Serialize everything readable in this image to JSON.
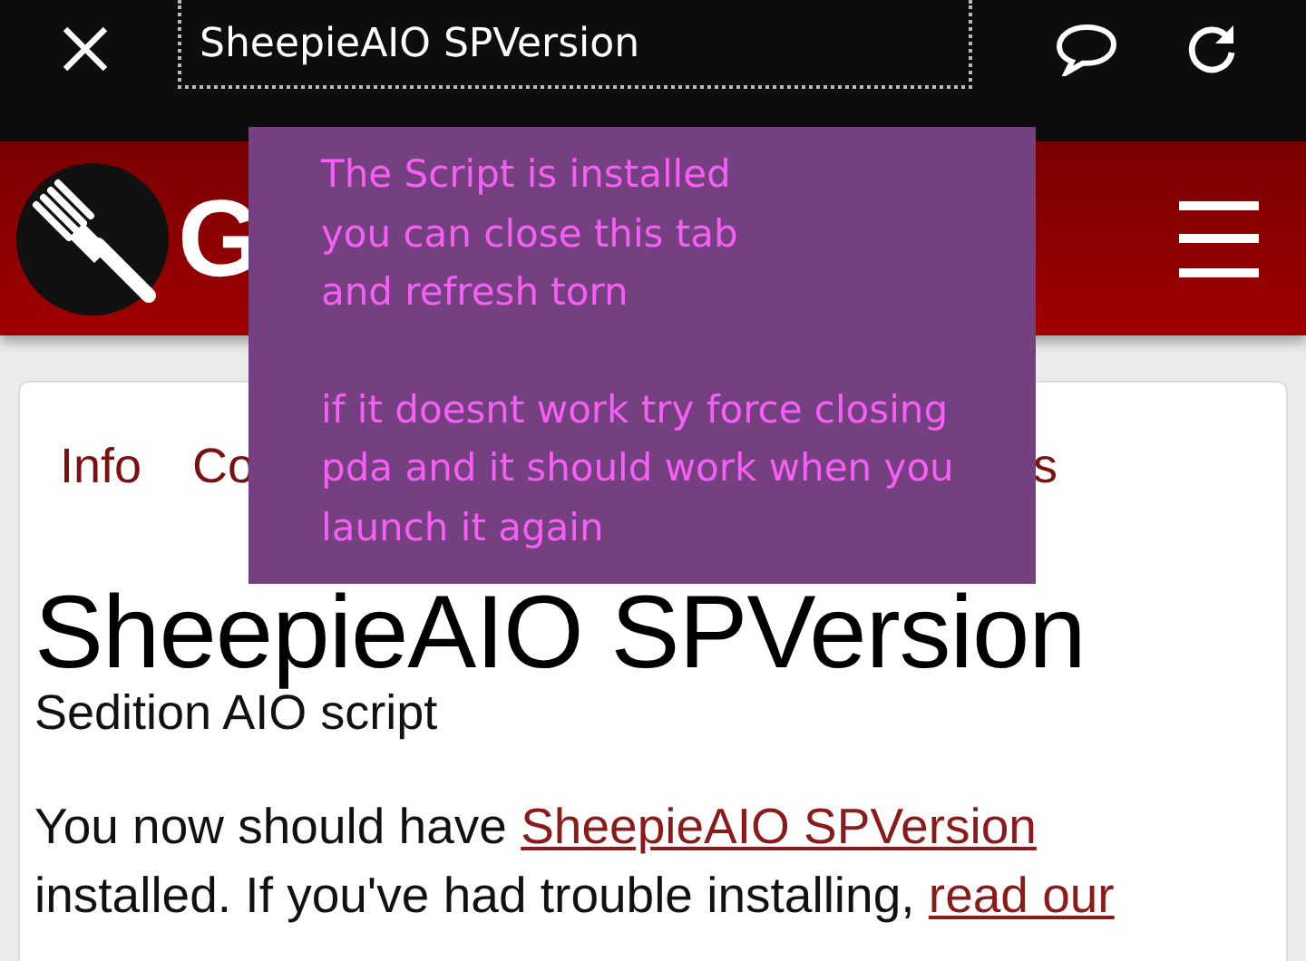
{
  "top_bar": {
    "url": "SheepieAIO SPVersion"
  },
  "header": {
    "brand": "G"
  },
  "tabs": [
    {
      "label": "Info"
    },
    {
      "label": "Co"
    },
    {
      "label": "s"
    }
  ],
  "script": {
    "title": "SheepieAIO SPVersion",
    "subtitle": "Sedition AIO script",
    "paragraph": [
      {
        "kind": "text",
        "text": "You now should have "
      },
      {
        "kind": "link",
        "text": "SheepieAIO SPVersion"
      },
      {
        "kind": "text",
        "text": " installed. If you've had trouble installing, "
      },
      {
        "kind": "link",
        "text": "read our"
      }
    ]
  },
  "overlay": {
    "messages": [
      {
        "lines": [
          "The Script is installed",
          "you can close this tab",
          "and refresh torn"
        ]
      },
      {
        "lines": [
          "if it doesnt work try force closing",
          "pda and it should work when you",
          "launch it again"
        ]
      }
    ]
  }
}
